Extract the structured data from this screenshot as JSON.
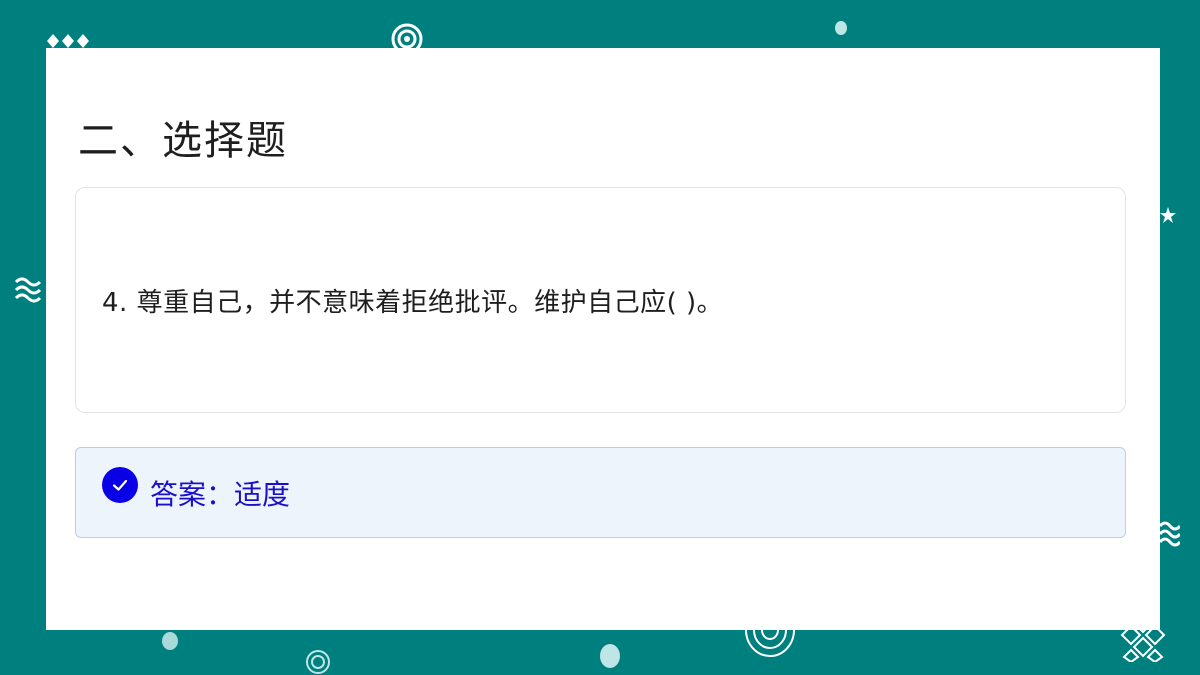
{
  "slide": {
    "heading": "二、选择题",
    "question": {
      "text": "4. 尊重自己，并不意味着拒绝批评。维护自己应( )。"
    },
    "answer": {
      "icon": "check-circle-icon",
      "text": "答案：适度"
    }
  },
  "colors": {
    "background": "#007f7f",
    "check_icon": "#0a00e8",
    "answer_text": "#1a10c8",
    "answer_bg": "#eef4fc"
  },
  "decorations": [
    "diamonds",
    "concentric-circles",
    "dot",
    "star",
    "waves",
    "lattice"
  ]
}
